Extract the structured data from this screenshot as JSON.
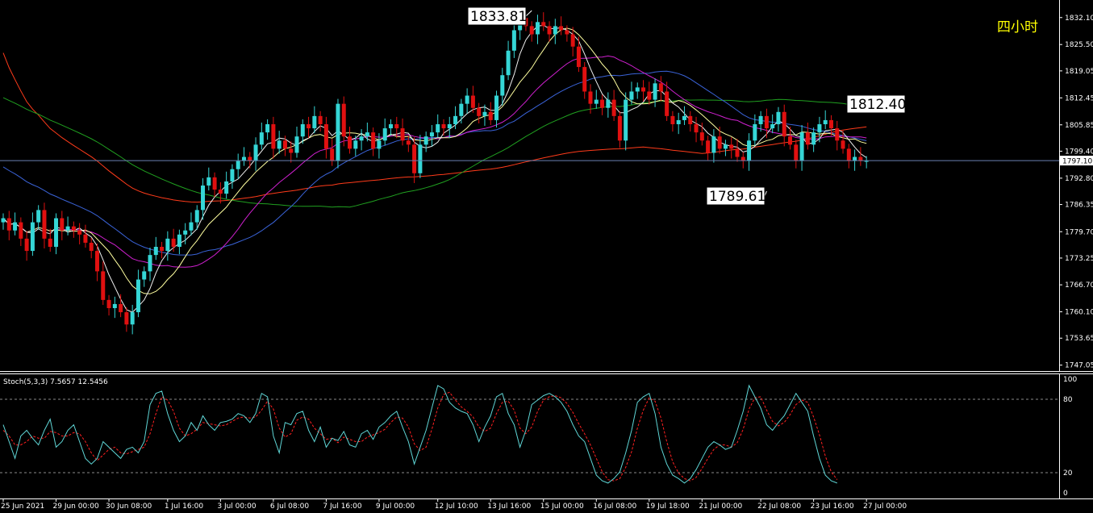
{
  "title": "四小时",
  "indicator_label": "Stoch(5,3,3) 7.5657 12.5456",
  "current_price": "1797.10",
  "colors": {
    "background": "#000000",
    "bull_candle": "#35d6d6",
    "bear_candle": "#e01010",
    "title": "#ffff00",
    "ma_red": "#ff3b1a",
    "ma_green": "#20a020",
    "ma_blue": "#3a63d8",
    "ma_magenta": "#d020d0",
    "ma_yellow": "#ffffa0",
    "ma_white": "#f0f0f0",
    "stoch_main": "#5fd6d6",
    "stoch_signal": "#ff2020",
    "price_line": "#6a7fb0"
  },
  "annotations": [
    {
      "text": "1833.81",
      "price": 1833.81,
      "bar": 90
    },
    {
      "text": "1812.40",
      "price": 1812.4,
      "bar": 148
    },
    {
      "text": "1789.61",
      "price": 1789.61,
      "bar": 130
    }
  ],
  "chart_data": [
    {
      "type": "candlestick",
      "title": "四小时",
      "y_ticks": [
        "1832.10",
        "1825.50",
        "1819.05",
        "1812.45",
        "1805.85",
        "1799.40",
        "1792.80",
        "1786.35",
        "1779.70",
        "1773.25",
        "1766.70",
        "1760.10",
        "1753.65",
        "1747.05"
      ],
      "ylim": [
        1746.0,
        1836.0
      ],
      "x_tick_labels": [
        "25 Jun 2021",
        "29 Jun 00:00",
        "30 Jun 08:00",
        "1 Jul 16:00",
        "3 Jul 00:00",
        "6 Jul 08:00",
        "7 Jul 16:00",
        "9 Jul 00:00",
        "12 Jul 10:00",
        "13 Jul 16:00",
        "15 Jul 00:00",
        "16 Jul 08:00",
        "19 Jul 18:00",
        "21 Jul 00:00",
        "22 Jul 08:00",
        "23 Jul 16:00",
        "27 Jul 00:00"
      ],
      "close": [
        1783,
        1780,
        1782,
        1778,
        1775,
        1782,
        1785,
        1778,
        1776,
        1783,
        1780,
        1781,
        1780,
        1779,
        1777,
        1775,
        1770,
        1763,
        1761,
        1762,
        1760,
        1757,
        1760,
        1768,
        1770,
        1774,
        1776,
        1775,
        1778,
        1776,
        1779,
        1780,
        1782,
        1785,
        1791,
        1793,
        1790,
        1789,
        1792,
        1795,
        1797,
        1798,
        1797,
        1801,
        1804,
        1806,
        1800,
        1802,
        1800,
        1799,
        1803,
        1806,
        1805,
        1808,
        1806,
        1800,
        1797,
        1811,
        1803,
        1800,
        1802,
        1803,
        1804,
        1800,
        1802,
        1805,
        1806,
        1805,
        1802,
        1801,
        1794,
        1801,
        1803,
        1804,
        1806,
        1805,
        1806,
        1808,
        1811,
        1813,
        1810,
        1808,
        1809,
        1807,
        1813,
        1818,
        1824,
        1829,
        1832,
        1830,
        1828,
        1831,
        1830,
        1828,
        1830,
        1829,
        1828,
        1825,
        1820,
        1814,
        1811,
        1812,
        1810,
        1812,
        1808,
        1802,
        1812,
        1814,
        1815,
        1814,
        1812,
        1816,
        1814,
        1808,
        1806,
        1807,
        1808,
        1806,
        1804,
        1802,
        1799,
        1803,
        1800,
        1801,
        1800,
        1798,
        1797,
        1802,
        1806,
        1808,
        1805,
        1806,
        1809,
        1803,
        1801,
        1797,
        1804,
        1801,
        1804,
        1806,
        1807,
        1805,
        1802,
        1800,
        1797,
        1798,
        1797,
        1797
      ],
      "open": [
        1782,
        1783,
        1780,
        1782,
        1778,
        1775,
        1782,
        1785,
        1778,
        1776,
        1783,
        1780,
        1781,
        1780,
        1779,
        1777,
        1775,
        1770,
        1763,
        1761,
        1762,
        1760,
        1757,
        1760,
        1768,
        1770,
        1774,
        1776,
        1775,
        1778,
        1776,
        1779,
        1780,
        1782,
        1785,
        1791,
        1793,
        1790,
        1789,
        1792,
        1795,
        1797,
        1798,
        1797,
        1801,
        1804,
        1806,
        1800,
        1802,
        1800,
        1799,
        1803,
        1806,
        1805,
        1808,
        1806,
        1800,
        1797,
        1811,
        1803,
        1800,
        1802,
        1803,
        1804,
        1800,
        1802,
        1805,
        1806,
        1805,
        1802,
        1801,
        1794,
        1801,
        1803,
        1804,
        1806,
        1805,
        1806,
        1808,
        1811,
        1813,
        1810,
        1808,
        1809,
        1807,
        1813,
        1818,
        1824,
        1829,
        1832,
        1830,
        1828,
        1831,
        1830,
        1828,
        1830,
        1829,
        1828,
        1825,
        1820,
        1814,
        1811,
        1812,
        1810,
        1812,
        1808,
        1802,
        1812,
        1814,
        1815,
        1814,
        1812,
        1816,
        1814,
        1808,
        1806,
        1807,
        1808,
        1806,
        1804,
        1802,
        1799,
        1803,
        1800,
        1801,
        1800,
        1798,
        1797,
        1802,
        1806,
        1808,
        1805,
        1806,
        1809,
        1803,
        1801,
        1797,
        1804,
        1801,
        1804,
        1806,
        1807,
        1805,
        1802,
        1800,
        1797,
        1798,
        1797
      ],
      "stoch_k": [
        60,
        45,
        30,
        50,
        55,
        48,
        42,
        55,
        65,
        40,
        45,
        55,
        60,
        45,
        30,
        25,
        30,
        45,
        40,
        35,
        30,
        38,
        40,
        35,
        45,
        78,
        88,
        90,
        70,
        55,
        45,
        50,
        62,
        55,
        68,
        60,
        55,
        62,
        63,
        65,
        70,
        68,
        62,
        70,
        88,
        85,
        50,
        35,
        62,
        60,
        70,
        72,
        55,
        45,
        58,
        40,
        48,
        46,
        54,
        42,
        40,
        52,
        55,
        47,
        58,
        62,
        68,
        72,
        58,
        45,
        25,
        40,
        55,
        75,
        95,
        92,
        80,
        75,
        72,
        70,
        60,
        45,
        58,
        68,
        85,
        88,
        70,
        60,
        40,
        55,
        78,
        82,
        86,
        88,
        85,
        80,
        72,
        60,
        50,
        45,
        30,
        15,
        10,
        8,
        12,
        18,
        35,
        55,
        80,
        85,
        88,
        70,
        40,
        25,
        15,
        12,
        8,
        12,
        20,
        30,
        40,
        45,
        42,
        38,
        40,
        55,
        72,
        95,
        85,
        75,
        60,
        55,
        62,
        68,
        78,
        88,
        80,
        72,
        50,
        30,
        15,
        10,
        8
      ],
      "stoch_d": [
        55,
        50,
        42,
        42,
        45,
        50,
        48,
        48,
        54,
        53,
        50,
        50,
        53,
        52,
        45,
        35,
        28,
        33,
        38,
        40,
        35,
        34,
        36,
        38,
        40,
        52,
        70,
        85,
        82,
        72,
        57,
        50,
        52,
        56,
        62,
        61,
        60,
        59,
        60,
        63,
        66,
        67,
        66,
        67,
        73,
        81,
        74,
        57,
        49,
        52,
        64,
        67,
        65,
        57,
        52,
        47,
        48,
        44,
        49,
        47,
        45,
        45,
        49,
        51,
        53,
        56,
        62,
        67,
        66,
        58,
        43,
        37,
        40,
        56,
        75,
        87,
        89,
        82,
        76,
        72,
        67,
        58,
        54,
        57,
        70,
        80,
        81,
        73,
        57,
        52,
        58,
        72,
        82,
        85,
        86,
        84,
        79,
        71,
        61,
        52,
        42,
        30,
        18,
        11,
        10,
        12,
        22,
        36,
        57,
        73,
        84,
        81,
        66,
        45,
        27,
        17,
        12,
        10,
        13,
        21,
        30,
        38,
        42,
        42,
        40,
        44,
        56,
        74,
        84,
        85,
        73,
        63,
        59,
        62,
        69,
        78,
        82,
        80,
        67,
        51,
        32,
        18,
        11
      ]
    }
  ]
}
